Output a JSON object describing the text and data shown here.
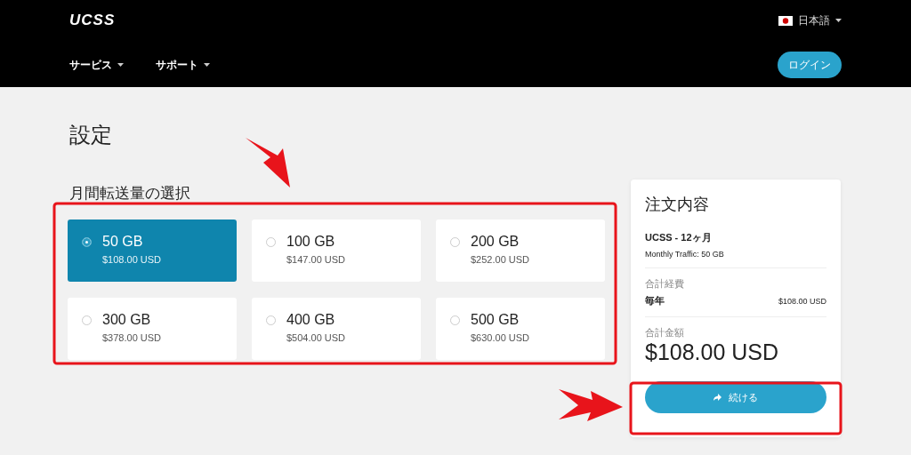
{
  "header": {
    "logo": "UCSS",
    "language": "日本語",
    "nav": [
      {
        "label": "サービス"
      },
      {
        "label": "サポート"
      }
    ],
    "login": "ログイン"
  },
  "page_title": "設定",
  "section_title": "月間転送量の選択",
  "plans": [
    {
      "size": "50 GB",
      "price": "$108.00 USD",
      "selected": true
    },
    {
      "size": "100 GB",
      "price": "$147.00 USD",
      "selected": false
    },
    {
      "size": "200 GB",
      "price": "$252.00 USD",
      "selected": false
    },
    {
      "size": "300 GB",
      "price": "$378.00 USD",
      "selected": false
    },
    {
      "size": "400 GB",
      "price": "$504.00 USD",
      "selected": false
    },
    {
      "size": "500 GB",
      "price": "$630.00 USD",
      "selected": false
    }
  ],
  "summary": {
    "title": "注文内容",
    "product": "UCSS - 12ヶ月",
    "detail": "Monthly Traffic: 50 GB",
    "cost_label": "合計経費",
    "period": "毎年",
    "period_price": "$108.00 USD",
    "total_label": "合計金額",
    "total": "$108.00 USD",
    "continue": "続ける"
  }
}
